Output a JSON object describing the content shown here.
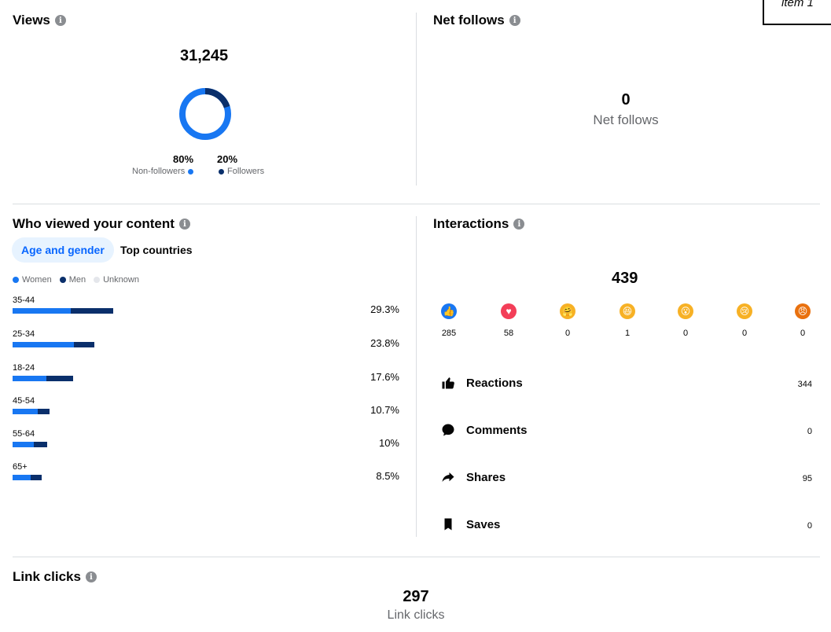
{
  "corner_tag": "item 1",
  "views": {
    "title": "Views",
    "total": "31,245",
    "non_followers_pct": "80%",
    "followers_pct": "20%",
    "non_followers_label": "Non-followers",
    "followers_label": "Followers",
    "non_followers_fraction": 0.8,
    "colors": {
      "non_followers": "#1877f2",
      "followers": "#0a2f6b"
    }
  },
  "net_follows": {
    "title": "Net follows",
    "value": "0",
    "label": "Net follows"
  },
  "who_viewed": {
    "title": "Who viewed your content",
    "tabs": [
      {
        "label": "Age and gender",
        "active": true
      },
      {
        "label": "Top countries",
        "active": false
      }
    ],
    "legend": [
      "Women",
      "Men",
      "Unknown"
    ],
    "rows": [
      {
        "age": "35-44",
        "pct": "29.3%",
        "women": 0.58,
        "men": 0.42,
        "share": 0.293
      },
      {
        "age": "25-34",
        "pct": "23.8%",
        "women": 0.75,
        "men": 0.25,
        "share": 0.238
      },
      {
        "age": "18-24",
        "pct": "17.6%",
        "women": 0.56,
        "men": 0.44,
        "share": 0.176
      },
      {
        "age": "45-54",
        "pct": "10.7%",
        "women": 0.68,
        "men": 0.32,
        "share": 0.107
      },
      {
        "age": "55-64",
        "pct": "10%",
        "women": 0.61,
        "men": 0.39,
        "share": 0.1
      },
      {
        "age": "65+",
        "pct": "8.5%",
        "women": 0.62,
        "men": 0.38,
        "share": 0.085
      }
    ]
  },
  "interactions": {
    "title": "Interactions",
    "total": "439",
    "reactions_breakdown": [
      {
        "icon": "like-icon",
        "count": "285",
        "color": "#1877f2"
      },
      {
        "icon": "love-icon",
        "count": "58",
        "color": "#f33e58"
      },
      {
        "icon": "care-icon",
        "count": "0",
        "color": "#f7b125"
      },
      {
        "icon": "haha-icon",
        "count": "1",
        "color": "#f7b125"
      },
      {
        "icon": "wow-icon",
        "count": "0",
        "color": "#f7b125"
      },
      {
        "icon": "sad-icon",
        "count": "0",
        "color": "#f7b125"
      },
      {
        "icon": "angry-icon",
        "count": "0",
        "color": "#e9710f"
      }
    ],
    "metrics": [
      {
        "icon": "thumbs-up-icon",
        "label": "Reactions",
        "value": "344"
      },
      {
        "icon": "comment-icon",
        "label": "Comments",
        "value": "0"
      },
      {
        "icon": "share-icon",
        "label": "Shares",
        "value": "95"
      },
      {
        "icon": "bookmark-icon",
        "label": "Saves",
        "value": "0"
      }
    ]
  },
  "link_clicks": {
    "title": "Link clicks",
    "value": "297",
    "label": "Link clicks"
  }
}
